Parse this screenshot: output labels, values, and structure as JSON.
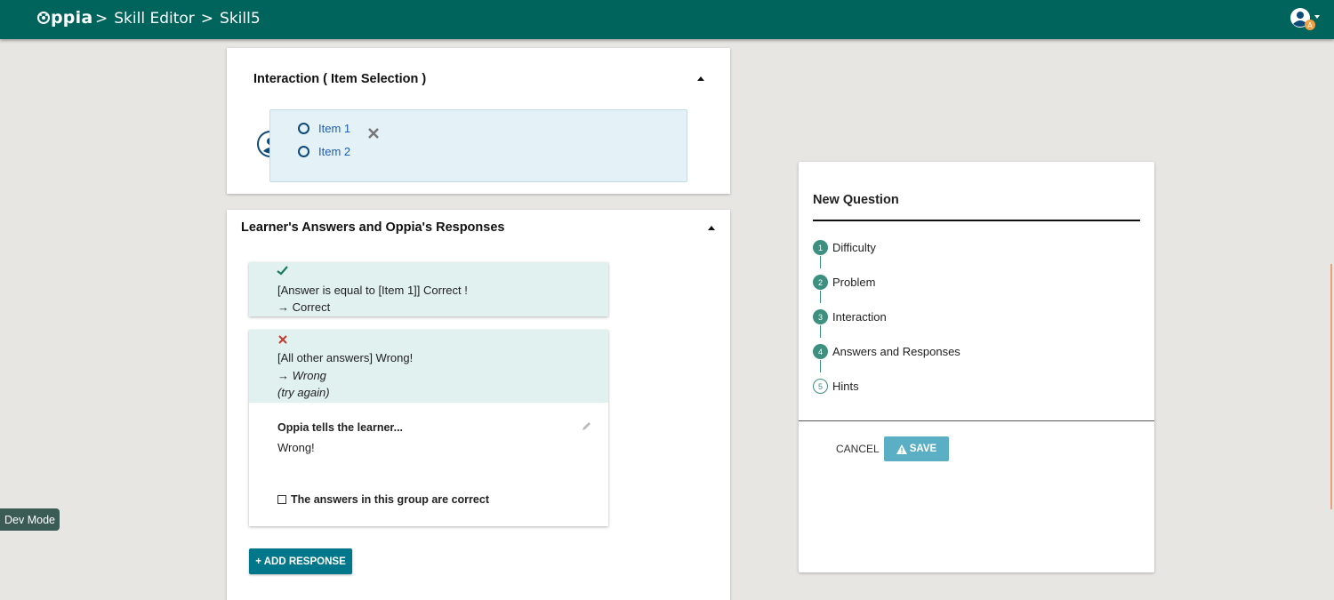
{
  "header": {
    "logo_text": "ppia",
    "breadcrumb": [
      ">",
      "Skill Editor",
      ">",
      "Skill5"
    ]
  },
  "interaction_card": {
    "title": "Interaction ( Item Selection )",
    "items": [
      "Item 1",
      "Item 2"
    ]
  },
  "answers_card": {
    "title": "Learner's Answers and Oppia's Responses",
    "groups": [
      {
        "rule": "[Answer is equal to [Item 1]] Correct !",
        "outcome": "→ Correct"
      },
      {
        "rule": "[All other answers] Wrong!",
        "outcome": "→ Wrong",
        "note": "(try again)",
        "feedback_label": "Oppia tells the learner...",
        "feedback_text": "Wrong!",
        "correct_checkbox_label": "The answers in this group are correct"
      }
    ],
    "add_response_label": "+ ADD RESPONSE"
  },
  "new_question": {
    "title": "New Question",
    "steps": [
      {
        "num": "1",
        "label": "Difficulty"
      },
      {
        "num": "2",
        "label": "Problem"
      },
      {
        "num": "3",
        "label": "Interaction"
      },
      {
        "num": "4",
        "label": "Answers and Responses"
      },
      {
        "num": "5",
        "label": "Hints"
      }
    ],
    "cancel_label": "CANCEL",
    "save_label": "SAVE"
  },
  "dev_mode_label": "Dev Mode",
  "colors": {
    "topbar": "#00645c",
    "accent": "#00778a",
    "step": "#3d8f80",
    "save_disabled": "#5aafc4",
    "answer_bg": "#e0f1f0"
  }
}
